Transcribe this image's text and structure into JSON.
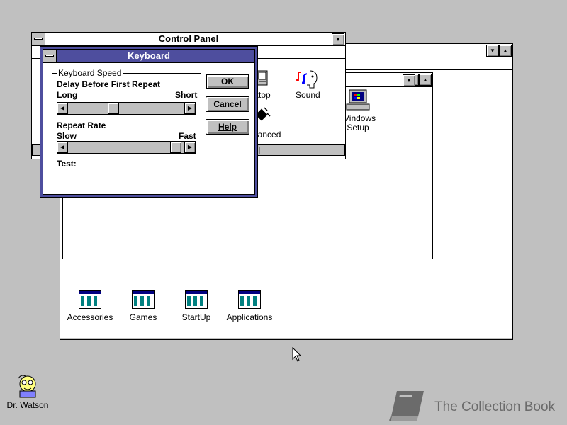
{
  "program_manager": {
    "groups": [
      {
        "label": "Accessories",
        "icon": "program-group-icon"
      },
      {
        "label": "Games",
        "icon": "program-group-icon"
      },
      {
        "label": "StartUp",
        "icon": "program-group-icon"
      },
      {
        "label": "Applications",
        "icon": "program-group-icon"
      }
    ]
  },
  "control_panel": {
    "title": "Control Panel",
    "icons": [
      {
        "label": "ktop",
        "icon": "desktop-icon"
      },
      {
        "label": "Sound",
        "icon": "sound-icon"
      },
      {
        "label": "hanced",
        "icon": "386-enhanced-icon"
      },
      {
        "label_line1": "Vindows",
        "label_line2": "Setup",
        "icon": "windows-setup-icon"
      }
    ]
  },
  "keyboard_dialog": {
    "title": "Keyboard",
    "group_label": "Keyboard Speed",
    "delay_label": "Delay Before First Repeat",
    "delay_min_label": "Long",
    "delay_max_label": "Short",
    "delay_value": 0.38,
    "repeat_label": "Repeat Rate",
    "repeat_min_label": "Slow",
    "repeat_max_label": "Fast",
    "repeat_value": 0.97,
    "test_label": "Test:",
    "buttons": {
      "ok": "OK",
      "cancel": "Cancel",
      "help": "Help"
    }
  },
  "desktop": {
    "dr_watson_label": "Dr. Watson",
    "watermark_text": "The Collection Book"
  },
  "colors": {
    "desktop": "#c0c0c0",
    "active_title": "#4e4e9e",
    "scrollbar": "#c0c0c0"
  }
}
